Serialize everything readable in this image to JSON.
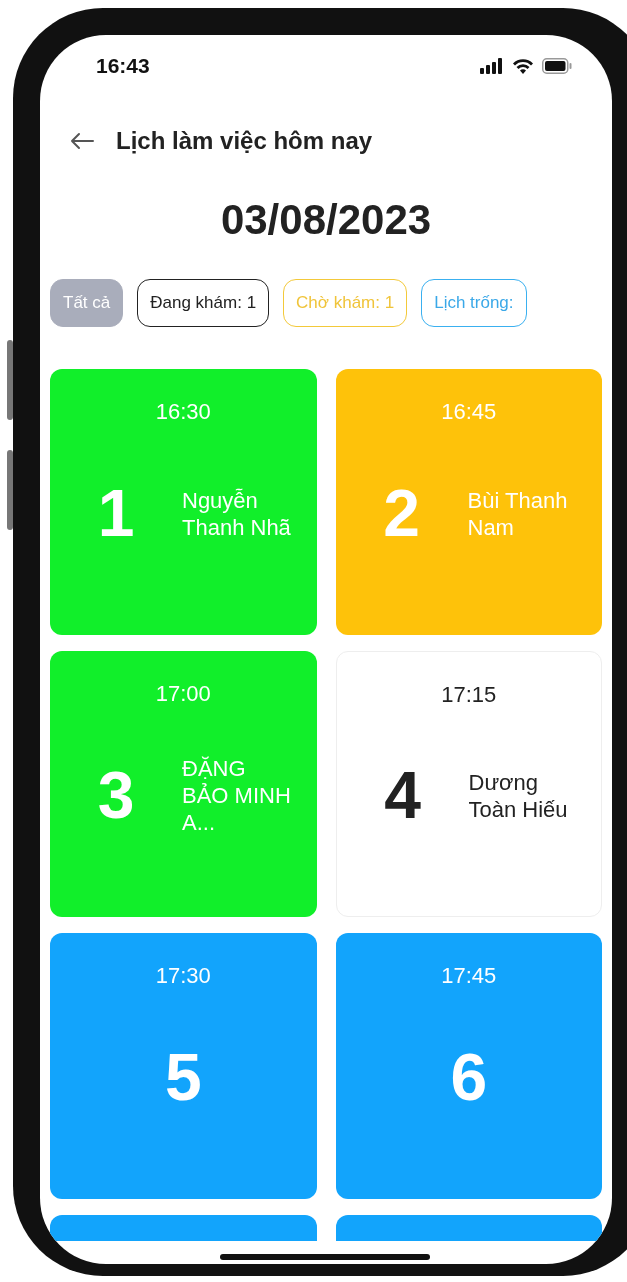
{
  "status_bar": {
    "time": "16:43"
  },
  "header": {
    "title": "Lịch làm việc hôm nay"
  },
  "date": "03/08/2023",
  "filters": [
    {
      "label": "Tất cả",
      "kind": "all",
      "selected": true
    },
    {
      "label": "Đang khám: 1",
      "kind": "in_progress",
      "selected": false
    },
    {
      "label": "Chờ khám: 1",
      "kind": "waiting",
      "selected": false
    },
    {
      "label": "Lịch trống:",
      "kind": "free",
      "selected": false
    }
  ],
  "slots": [
    {
      "time": "16:30",
      "number": "1",
      "name": "Nguyễn Thanh Nhã",
      "kind": "in_progress"
    },
    {
      "time": "16:45",
      "number": "2",
      "name": "Bùi Thanh Nam",
      "kind": "waiting"
    },
    {
      "time": "17:00",
      "number": "3",
      "name": "ĐẶNG BẢO MINH A...",
      "kind": "in_progress"
    },
    {
      "time": "17:15",
      "number": "4",
      "name": "Dương Toàn Hiếu",
      "kind": "booked"
    },
    {
      "time": "17:30",
      "number": "5",
      "kind": "free"
    },
    {
      "time": "17:45",
      "number": "6",
      "kind": "free"
    },
    {
      "kind": "free"
    },
    {
      "kind": "free"
    }
  ]
}
